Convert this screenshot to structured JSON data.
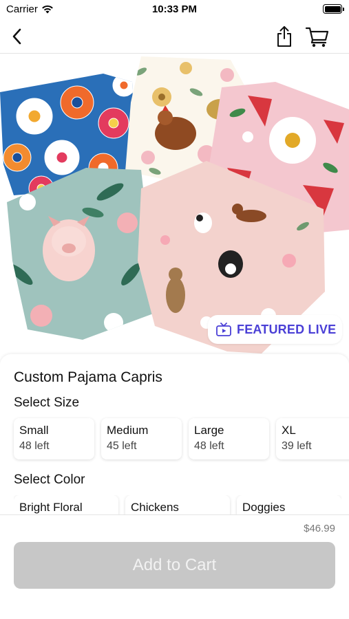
{
  "status_bar": {
    "carrier": "Carrier",
    "time": "10:33 PM",
    "icons": [
      "wifi-icon",
      "battery-icon"
    ]
  },
  "nav": {
    "icons": [
      "chevron-left-icon",
      "share-icon",
      "cart-icon"
    ]
  },
  "hero": {
    "badge_icon": "tv-play-icon",
    "badge_label": "FEATURED LIVE"
  },
  "product": {
    "title": "Custom Pajama Capris",
    "size_heading": "Select Size",
    "sizes": [
      {
        "name": "Small",
        "stock": "48 left"
      },
      {
        "name": "Medium",
        "stock": "45 left"
      },
      {
        "name": "Large",
        "stock": "48 left"
      },
      {
        "name": "XL",
        "stock": "39 left"
      }
    ],
    "color_heading": "Select Color",
    "colors": [
      {
        "name": "Bright Floral"
      },
      {
        "name": "Chickens"
      },
      {
        "name": "Doggies"
      }
    ]
  },
  "footer": {
    "price": "$46.99",
    "add_to_cart_label": "Add to Cart"
  },
  "colors": {
    "accent": "#4a3fd6",
    "button_disabled": "#c7c7c7",
    "button_text": "#f2f2f2"
  }
}
